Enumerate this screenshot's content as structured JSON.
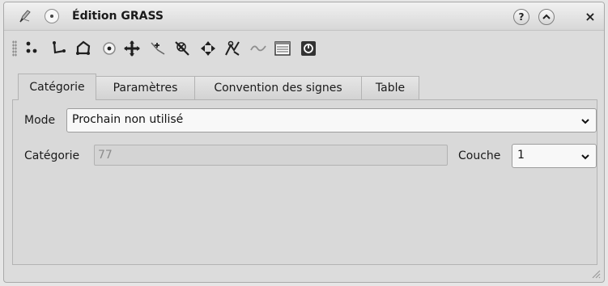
{
  "window": {
    "title": "Édition GRASS"
  },
  "titlebar": {
    "app_icon": "grass-pencil-icon",
    "menu_icon": "window-menu-icon",
    "help_label": "?",
    "shade_label": "^",
    "close_label": "×"
  },
  "toolbar": {
    "tools": [
      "new-point-icon",
      "new-line-icon",
      "new-boundary-icon",
      "new-centroid-icon",
      "move-vertex-icon",
      "add-vertex-icon",
      "delete-vertex-icon",
      "move-element-icon",
      "split-line-icon",
      "delete-element-icon",
      "edit-attributes-icon",
      "close-icon"
    ]
  },
  "tabs": [
    {
      "label": "Catégorie",
      "active": true
    },
    {
      "label": "Paramètres",
      "active": false
    },
    {
      "label": "Convention des signes",
      "active": false
    },
    {
      "label": "Table",
      "active": false
    }
  ],
  "category_tab": {
    "mode_label": "Mode",
    "mode_value": "Prochain non utilisé",
    "category_label": "Catégorie",
    "category_value": "77",
    "layer_label": "Couche",
    "layer_value": "1"
  },
  "colors": {
    "window_bg": "#dcdcdc",
    "titlebar_top": "#f1f1f1",
    "titlebar_bottom": "#d7d7d7",
    "tool_stroke": "#1f1f1f"
  }
}
